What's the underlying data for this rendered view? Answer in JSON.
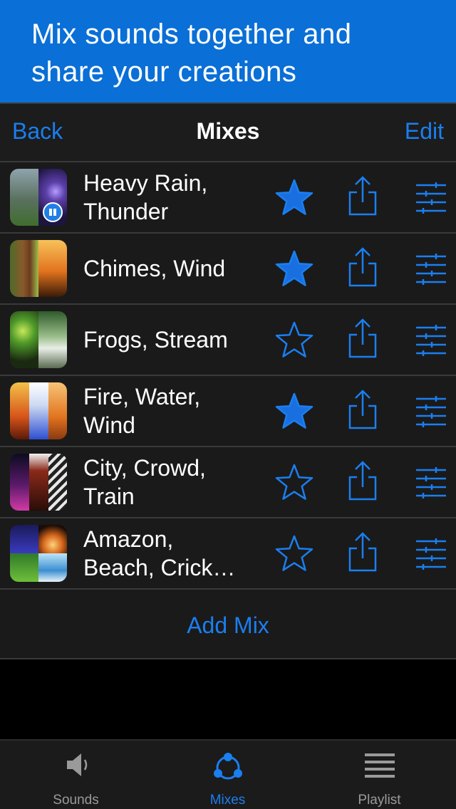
{
  "promo": {
    "line1": "Mix sounds together and",
    "line2": "share your creations",
    "background": "#0a6fd6"
  },
  "navbar": {
    "back_label": "Back",
    "title": "Mixes",
    "edit_label": "Edit"
  },
  "mixes": [
    {
      "line1": "Heavy Rain,",
      "line2": "Thunder",
      "favorite": true,
      "playing": true
    },
    {
      "line1": "Chimes, Wind",
      "line2": "",
      "favorite": true,
      "playing": false
    },
    {
      "line1": "Frogs, Stream",
      "line2": "",
      "favorite": false,
      "playing": false
    },
    {
      "line1": "Fire, Water,",
      "line2": "Wind",
      "favorite": true,
      "playing": false
    },
    {
      "line1": "City, Crowd,",
      "line2": "Train",
      "favorite": false,
      "playing": false
    },
    {
      "line1": "Amazon,",
      "line2": "Beach, Crick…",
      "favorite": false,
      "playing": false
    }
  ],
  "add_mix_label": "Add Mix",
  "tabs": [
    {
      "label": "Sounds",
      "icon": "speaker-icon",
      "active": false
    },
    {
      "label": "Mixes",
      "icon": "mixes-icon",
      "active": true
    },
    {
      "label": "Playlist",
      "icon": "list-icon",
      "active": false
    }
  ],
  "colors": {
    "accent": "#1a7ff0",
    "row_background": "#1a1a1a",
    "separator": "#3a3a3a"
  }
}
